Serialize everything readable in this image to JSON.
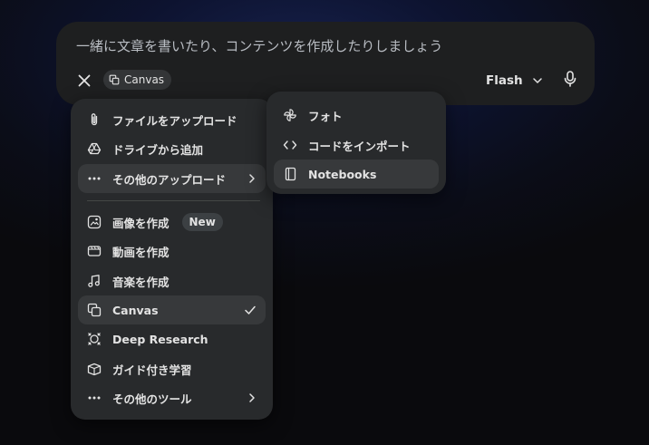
{
  "composer": {
    "placeholder": "一緒に文章を書いたり、コンテンツを作成したりしましょう",
    "tool_chip_label": "Canvas",
    "model_label": "Flash"
  },
  "upload_menu": {
    "items": [
      {
        "label": "ファイルをアップロード",
        "icon": "paperclip-icon"
      },
      {
        "label": "ドライブから追加",
        "icon": "drive-icon"
      },
      {
        "label": "その他のアップロード",
        "icon": "more-horiz-icon",
        "submenu": true
      }
    ]
  },
  "tools_menu": {
    "items": [
      {
        "label": "画像を作成",
        "icon": "image-create-icon",
        "badge": "New"
      },
      {
        "label": "動画を作成",
        "icon": "video-icon"
      },
      {
        "label": "音楽を作成",
        "icon": "music-note-icon"
      },
      {
        "label": "Canvas",
        "icon": "canvas-icon",
        "selected": true
      },
      {
        "label": "Deep Research",
        "icon": "deep-research-icon"
      },
      {
        "label": "ガイド付き学習",
        "icon": "guided-learning-icon"
      },
      {
        "label": "その他のツール",
        "icon": "more-horiz-icon",
        "submenu": true
      }
    ]
  },
  "more_uploads_submenu": {
    "items": [
      {
        "label": "フォト",
        "icon": "photos-pinwheel-icon"
      },
      {
        "label": "コードをインポート",
        "icon": "code-icon"
      },
      {
        "label": "Notebooks",
        "icon": "notebook-icon",
        "hovered": true
      }
    ]
  }
}
